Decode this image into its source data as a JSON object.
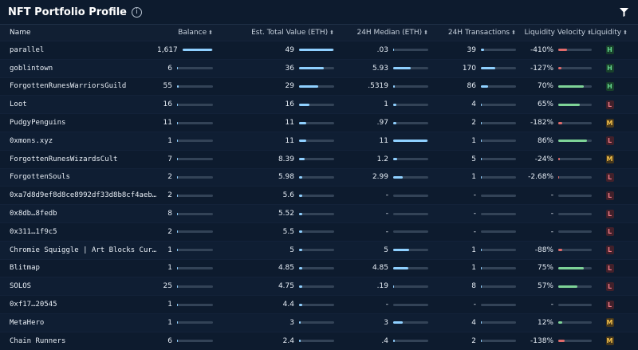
{
  "title": "NFT Portfolio Profile",
  "columns": {
    "name": "Name",
    "balance": "Balance",
    "value": "Est. Total Value (ETH)",
    "median": "24H Median (ETH)",
    "tx": "24H Transactions",
    "velocity": "Liquidity Velocity",
    "liquidity": "Liquidity"
  },
  "rows": [
    {
      "name": "parallel",
      "balance": "1,617",
      "value": "49",
      "median": ".03",
      "tx": "39",
      "velocity": "-410%",
      "liquidity": "H"
    },
    {
      "name": "goblintown",
      "balance": "6",
      "value": "36",
      "median": "5.93",
      "tx": "170",
      "velocity": "-127%",
      "liquidity": "H"
    },
    {
      "name": "ForgottenRunesWarriorsGuild",
      "balance": "55",
      "value": "29",
      "median": ".5319",
      "tx": "86",
      "velocity": "70%",
      "liquidity": "H"
    },
    {
      "name": "Loot",
      "balance": "16",
      "value": "16",
      "median": "1",
      "tx": "4",
      "velocity": "65%",
      "liquidity": "L"
    },
    {
      "name": "PudgyPenguins",
      "balance": "11",
      "value": "11",
      "median": ".97",
      "tx": "2",
      "velocity": "-182%",
      "liquidity": "M"
    },
    {
      "name": "0xmons.xyz",
      "balance": "1",
      "value": "11",
      "median": "11",
      "tx": "1",
      "velocity": "86%",
      "liquidity": "L"
    },
    {
      "name": "ForgottenRunesWizardsCult",
      "balance": "7",
      "value": "8.39",
      "median": "1.2",
      "tx": "5",
      "velocity": "-24%",
      "liquidity": "M"
    },
    {
      "name": "ForgottenSouls",
      "balance": "2",
      "value": "5.98",
      "median": "2.99",
      "tx": "1",
      "velocity": "-2.68%",
      "liquidity": "L"
    },
    {
      "name": "0xa7d8d9ef8d8ce8992df33d8b8cf4aeb…",
      "balance": "2",
      "value": "5.6",
      "median": "-",
      "tx": "-",
      "velocity": "-",
      "liquidity": "L"
    },
    {
      "name": "0x8db…8fedb",
      "balance": "8",
      "value": "5.52",
      "median": "-",
      "tx": "-",
      "velocity": "-",
      "liquidity": "L"
    },
    {
      "name": "0x311…1f9c5",
      "balance": "2",
      "value": "5.5",
      "median": "-",
      "tx": "-",
      "velocity": "-",
      "liquidity": "L"
    },
    {
      "name": "Chromie Squiggle | Art Blocks Cur…",
      "balance": "1",
      "value": "5",
      "median": "5",
      "tx": "1",
      "velocity": "-88%",
      "liquidity": "L"
    },
    {
      "name": "Blitmap",
      "balance": "1",
      "value": "4.85",
      "median": "4.85",
      "tx": "1",
      "velocity": "75%",
      "liquidity": "L"
    },
    {
      "name": "SOLOS",
      "balance": "25",
      "value": "4.75",
      "median": ".19",
      "tx": "8",
      "velocity": "57%",
      "liquidity": "L"
    },
    {
      "name": "0xf17…20545",
      "balance": "1",
      "value": "4.4",
      "median": "-",
      "tx": "-",
      "velocity": "-",
      "liquidity": "L"
    },
    {
      "name": "MetaHero",
      "balance": "1",
      "value": "3",
      "median": "3",
      "tx": "4",
      "velocity": "12%",
      "liquidity": "M"
    },
    {
      "name": "Chain Runners",
      "balance": "6",
      "value": "2.4",
      "median": ".4",
      "tx": "2",
      "velocity": "-138%",
      "liquidity": "M"
    }
  ],
  "bars": [
    {
      "b": 0.98,
      "v": 0.98,
      "m": 0.01,
      "t": 0.1,
      "l": 0.25,
      "lc": "r"
    },
    {
      "b": 0.02,
      "v": 0.7,
      "m": 0.5,
      "t": 0.4,
      "l": 0.1,
      "lc": "r"
    },
    {
      "b": 0.05,
      "v": 0.55,
      "m": 0.05,
      "t": 0.2,
      "l": 0.75,
      "lc": "g"
    },
    {
      "b": 0.02,
      "v": 0.3,
      "m": 0.09,
      "t": 0.02,
      "l": 0.65,
      "lc": "g"
    },
    {
      "b": 0.02,
      "v": 0.2,
      "m": 0.09,
      "t": 0.01,
      "l": 0.12,
      "lc": "r"
    },
    {
      "b": 0.01,
      "v": 0.2,
      "m": 0.98,
      "t": 0.01,
      "l": 0.86,
      "lc": "g"
    },
    {
      "b": 0.02,
      "v": 0.15,
      "m": 0.11,
      "t": 0.02,
      "l": 0.05,
      "lc": "r"
    },
    {
      "b": 0.01,
      "v": 0.1,
      "m": 0.27,
      "t": 0.01,
      "l": 0.03,
      "lc": "r"
    },
    {
      "b": 0.01,
      "v": 0.1,
      "m": 0,
      "t": 0,
      "l": 0,
      "lc": "g"
    },
    {
      "b": 0.02,
      "v": 0.1,
      "m": 0,
      "t": 0,
      "l": 0,
      "lc": "g"
    },
    {
      "b": 0.01,
      "v": 0.1,
      "m": 0,
      "t": 0,
      "l": 0,
      "lc": "g"
    },
    {
      "b": 0.01,
      "v": 0.1,
      "m": 0.45,
      "t": 0.01,
      "l": 0.12,
      "lc": "r"
    },
    {
      "b": 0.01,
      "v": 0.09,
      "m": 0.44,
      "t": 0.01,
      "l": 0.75,
      "lc": "g"
    },
    {
      "b": 0.02,
      "v": 0.09,
      "m": 0.02,
      "t": 0.02,
      "l": 0.57,
      "lc": "g"
    },
    {
      "b": 0.01,
      "v": 0.08,
      "m": 0,
      "t": 0,
      "l": 0,
      "lc": "g"
    },
    {
      "b": 0.01,
      "v": 0.05,
      "m": 0.28,
      "t": 0.01,
      "l": 0.12,
      "lc": "g"
    },
    {
      "b": 0.02,
      "v": 0.04,
      "m": 0.04,
      "t": 0.01,
      "l": 0.2,
      "lc": "r"
    }
  ]
}
